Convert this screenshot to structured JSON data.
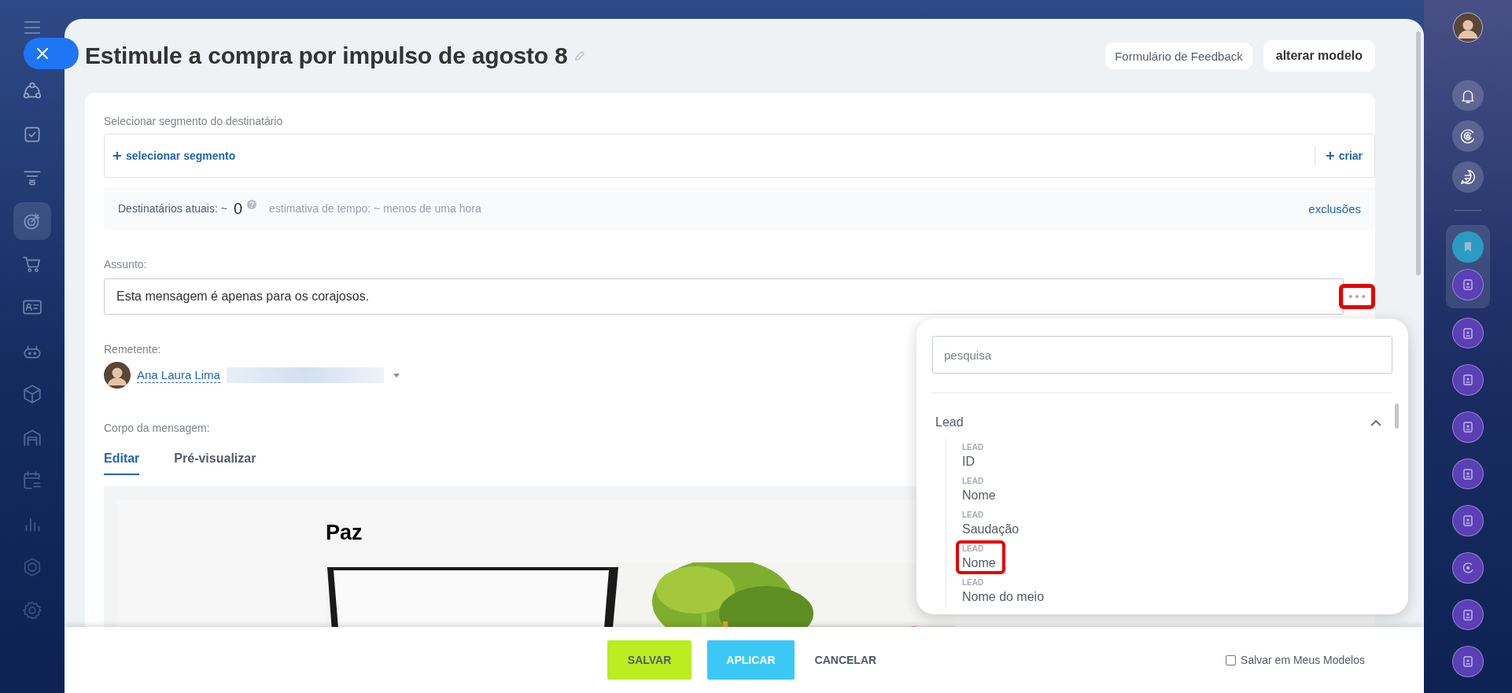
{
  "sidebar": {
    "items": [
      {
        "selected": false
      },
      {
        "selected": false
      },
      {
        "selected": false
      },
      {
        "selected": true
      },
      {
        "selected": false
      },
      {
        "selected": false
      },
      {
        "selected": false
      },
      {
        "selected": false
      },
      {
        "selected": false
      },
      {
        "selected": false
      },
      {
        "selected": false
      },
      {
        "selected": false
      },
      {
        "selected": false
      }
    ]
  },
  "title": "Estimule a compra por impulso de agosto 8",
  "header_buttons": [
    {
      "label": "Formulário de Feedback",
      "kind": "plain"
    },
    {
      "label": "alterar modelo",
      "kind": "strong"
    }
  ],
  "segment": {
    "label": "Selecionar segmento do destinatário",
    "select_link": "selecionar segmento",
    "create_link": "criar"
  },
  "recipients": {
    "label": "Destinatários atuais: ~",
    "count": "0",
    "estimate": "estimativa de tempo: ~ menos de uma hora",
    "exclusions_link": "exclusões"
  },
  "subject": {
    "label": "Assunto:",
    "value": "Esta mensagem é apenas para os corajosos.",
    "menu_highlighted": true
  },
  "sender": {
    "label": "Remetente:",
    "name": "Ana Laura Lima"
  },
  "body": {
    "label": "Corpo da mensagem:",
    "tabs": [
      {
        "label": "Editar",
        "selected": true
      },
      {
        "label": "Pré-visualizar",
        "selected": false
      }
    ],
    "heading": "Paz"
  },
  "field_menu": {
    "search": {
      "placeholder": "pesquisa"
    },
    "groups": [
      {
        "title": "Lead",
        "expanded": true,
        "items": [
          {
            "category": "LEAD",
            "name": "ID",
            "highlighted": false
          },
          {
            "category": "LEAD",
            "name": "Nome",
            "highlighted": false
          },
          {
            "category": "LEAD",
            "name": "Saudação",
            "highlighted": false
          },
          {
            "category": "LEAD",
            "name": "Nome",
            "highlighted": true
          },
          {
            "category": "LEAD",
            "name": "Nome do meio",
            "highlighted": false
          }
        ]
      }
    ]
  },
  "footer": {
    "buttons": [
      {
        "label": "SALVAR",
        "kind": "save"
      },
      {
        "label": "APLICAR",
        "kind": "apply"
      },
      {
        "label": "CANCELAR",
        "kind": "cancel"
      }
    ],
    "save_template": {
      "label": "Salvar em Meus Modelos",
      "checked": false
    }
  }
}
